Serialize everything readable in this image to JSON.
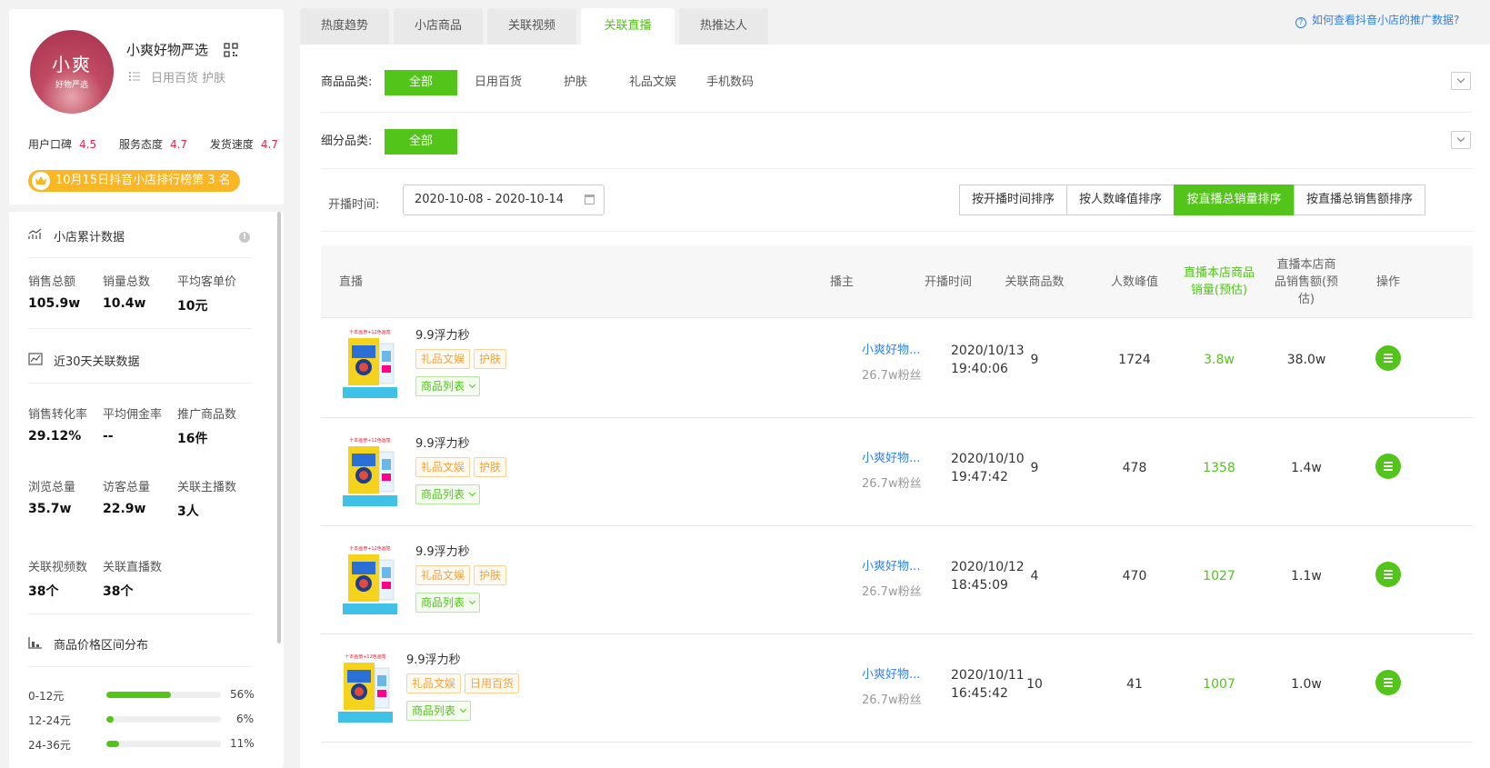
{
  "shop": {
    "avatar_big": "小爽",
    "avatar_small": "好物严选",
    "name": "小爽好物严选",
    "categories": "日用百货 护肤",
    "ratings": [
      {
        "label": "用户口碑",
        "value": "4.5"
      },
      {
        "label": "服务态度",
        "value": "4.7"
      },
      {
        "label": "发货速度",
        "value": "4.7"
      }
    ],
    "rank_badge": "10月15日抖音小店排行榜第 3 名"
  },
  "cumulative": {
    "title": "小店累计数据",
    "stats": [
      {
        "label": "销售总额",
        "value": "105.9w"
      },
      {
        "label": "销量总数",
        "value": "10.4w"
      },
      {
        "label": "平均客单价",
        "value": "10元"
      }
    ]
  },
  "recent30": {
    "title": "近30天关联数据",
    "stats": [
      {
        "label": "销售转化率",
        "value": "29.12%"
      },
      {
        "label": "平均佣金率",
        "value": "--"
      },
      {
        "label": "推广商品数",
        "value": "16件"
      },
      {
        "label": "浏览总量",
        "value": "35.7w"
      },
      {
        "label": "访客总量",
        "value": "22.9w"
      },
      {
        "label": "关联主播数",
        "value": "3人"
      },
      {
        "label": "关联视频数",
        "value": "38个"
      },
      {
        "label": "关联直播数",
        "value": "38个"
      }
    ]
  },
  "price_dist": {
    "title": "商品价格区间分布",
    "rows": [
      {
        "range": "0-12元",
        "pct": "56%",
        "fraction": 0.56
      },
      {
        "range": "12-24元",
        "pct": "6%",
        "fraction": 0.06
      },
      {
        "range": "24-36元",
        "pct": "11%",
        "fraction": 0.11
      }
    ]
  },
  "tabs": [
    "热度趋势",
    "小店商品",
    "关联视频",
    "关联直播",
    "热推达人"
  ],
  "active_tab": 3,
  "help_link": "如何查看抖音小店的推广数据?",
  "filters": {
    "category_label": "商品品类:",
    "categories": [
      "全部",
      "日用百货",
      "护肤",
      "礼品文娱",
      "手机数码"
    ],
    "sub_label": "细分品类:",
    "sub_categories": [
      "全部"
    ]
  },
  "date": {
    "label": "开播时间:",
    "value": "2020-10-08 - 2020-10-14"
  },
  "sort_buttons": [
    "按开播时间排序",
    "按人数峰值排序",
    "按直播总销量排序",
    "按直播总销售额排序"
  ],
  "active_sort": 2,
  "table": {
    "headers": {
      "live": "直播",
      "anchor": "播主",
      "start": "开播时间",
      "goods": "关联商品数",
      "peak": "人数峰值",
      "sales_vol": "直播本店商品销量(预估)",
      "sales_amt": "直播本店商品销售额(预估)",
      "op": "操作"
    },
    "product_list_label": "商品列表",
    "rows": [
      {
        "title": "9.9浮力秒",
        "tags": [
          "礼品文娱",
          "护肤"
        ],
        "anchor": "小爽好物...",
        "fans": "26.7w粉丝",
        "date": "2020/10/13",
        "time": "19:40:06",
        "goods": "9",
        "peak": "1724",
        "sales_vol": "3.8w",
        "sales_amt": "38.0w"
      },
      {
        "title": "9.9浮力秒",
        "tags": [
          "礼品文娱",
          "护肤"
        ],
        "anchor": "小爽好物...",
        "fans": "26.7w粉丝",
        "date": "2020/10/10",
        "time": "19:47:42",
        "goods": "9",
        "peak": "478",
        "sales_vol": "1358",
        "sales_amt": "1.4w"
      },
      {
        "title": "9.9浮力秒",
        "tags": [
          "礼品文娱",
          "护肤"
        ],
        "anchor": "小爽好物...",
        "fans": "26.7w粉丝",
        "date": "2020/10/12",
        "time": "18:45:09",
        "goods": "4",
        "peak": "470",
        "sales_vol": "1027",
        "sales_amt": "1.1w"
      },
      {
        "title": "9.9浮力秒",
        "tags": [
          "礼品文娱",
          "日用百货"
        ],
        "anchor": "小爽好物...",
        "fans": "26.7w粉丝",
        "date": "2020/10/11",
        "time": "16:45:42",
        "goods": "10",
        "peak": "41",
        "sales_vol": "1007",
        "sales_amt": "1.0w"
      }
    ]
  },
  "colors": {
    "accent": "#52c41a",
    "link": "#2f80ed",
    "rating": "#e8234a",
    "badge": "#fbb626"
  }
}
